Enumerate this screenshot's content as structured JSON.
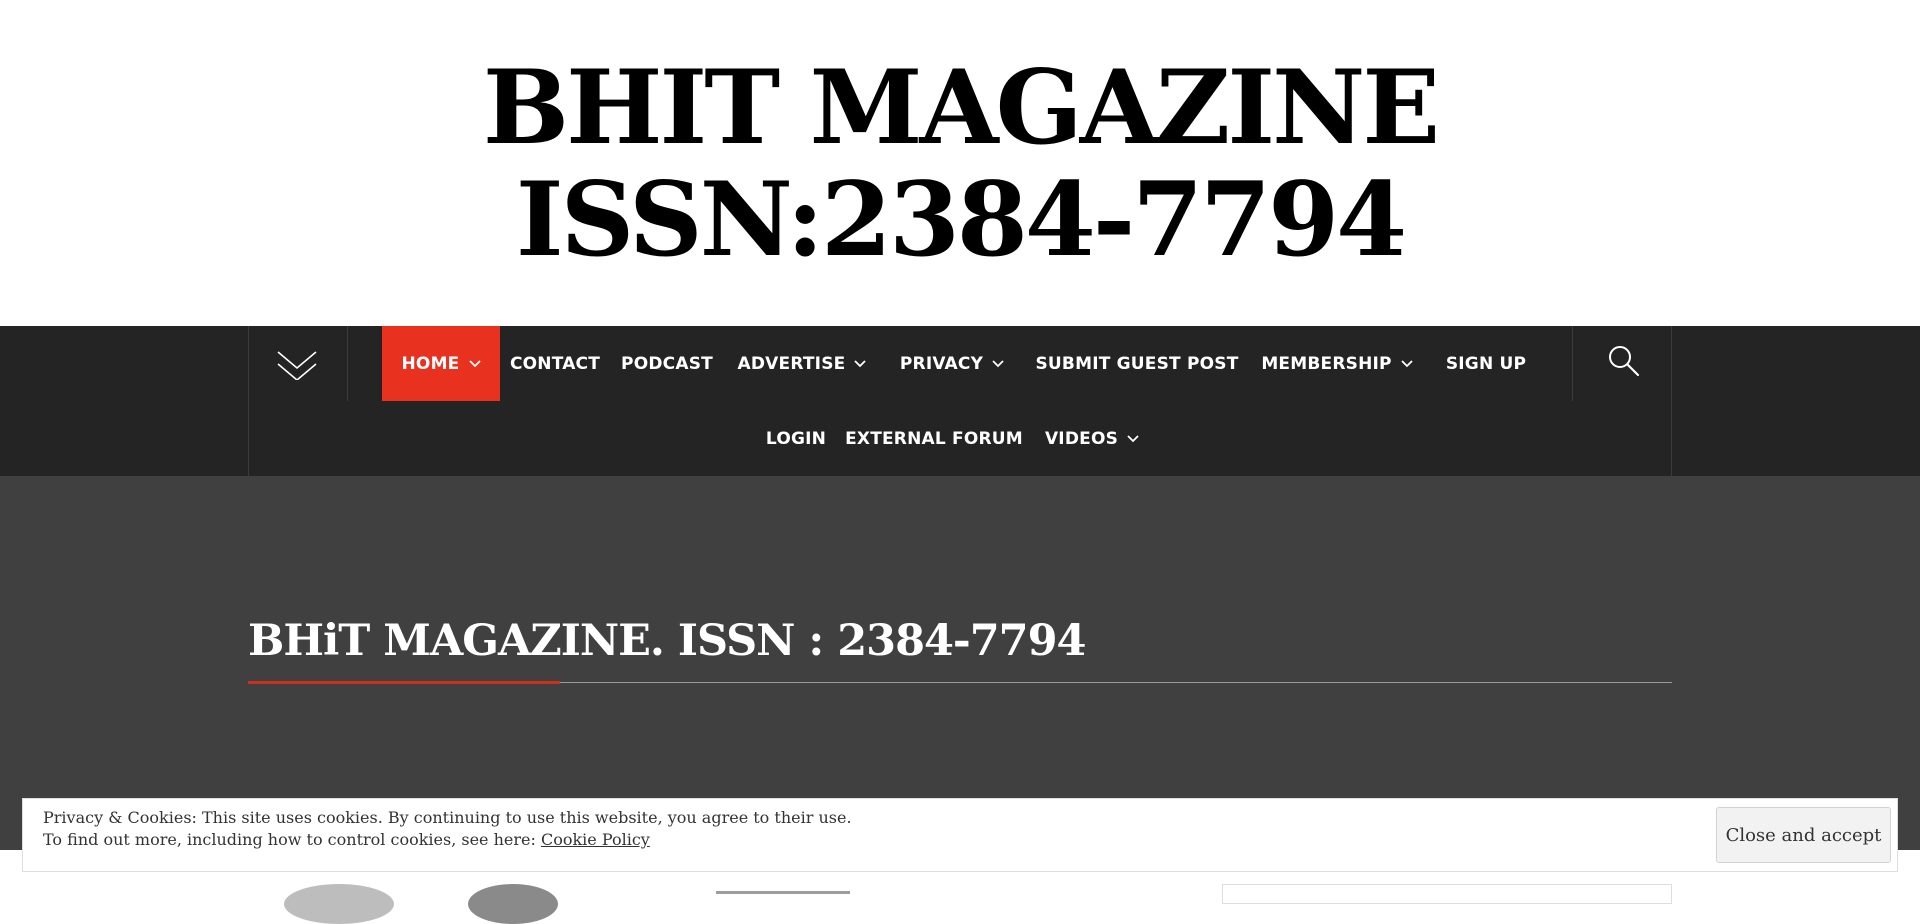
{
  "site": {
    "title_line1": "BHIT MAGAZINE",
    "title_line2": "ISSN:2384-7794"
  },
  "nav": {
    "primary": [
      {
        "label": "HOME",
        "has_submenu": true,
        "active": true
      },
      {
        "label": "CONTACT",
        "has_submenu": false
      },
      {
        "label": "PODCAST",
        "has_submenu": false
      },
      {
        "label": "ADVERTISE",
        "has_submenu": true
      },
      {
        "label": "PRIVACY",
        "has_submenu": true
      },
      {
        "label": "SUBMIT GUEST POST",
        "has_submenu": false
      },
      {
        "label": "MEMBERSHIP",
        "has_submenu": true
      },
      {
        "label": "SIGN UP",
        "has_submenu": false
      },
      {
        "label": "LOGIN",
        "has_submenu": false
      },
      {
        "label": "EXTERNAL FORUM",
        "has_submenu": false
      },
      {
        "label": "VIDEOS",
        "has_submenu": true
      }
    ],
    "menu_toggle_icon": "chevron-down-icon",
    "search_icon": "search-icon"
  },
  "page": {
    "title": "BHiT MAGAZINE. ISSN : 2384-7794"
  },
  "cookie_banner": {
    "line1": "Privacy & Cookies: This site uses cookies. By continuing to use this website, you agree to their use.",
    "line2_prefix": "To find out more, including how to control cookies, see here: ",
    "link_label": "Cookie Policy",
    "button_label": "Close and accept"
  },
  "colors": {
    "nav_background": "#242424",
    "accent": "#e8311f",
    "hero_background": "#404040"
  }
}
